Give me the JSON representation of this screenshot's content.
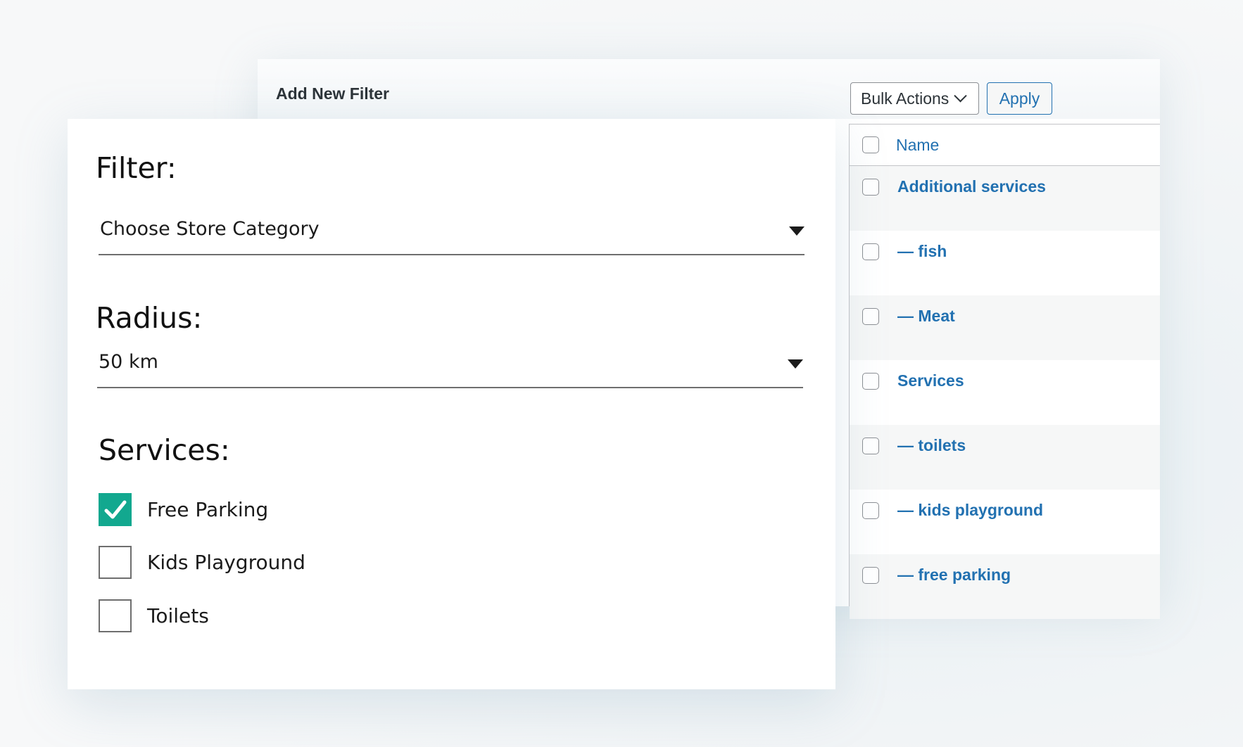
{
  "admin_panel": {
    "title": "Add New Filter",
    "bulk_actions": {
      "selected": "Bulk Actions"
    },
    "apply_label": "Apply",
    "table": {
      "column_header": "Name",
      "rows": [
        {
          "name": "Additional services"
        },
        {
          "name": "— fish"
        },
        {
          "name": "— Meat"
        },
        {
          "name": "Services"
        },
        {
          "name": "— toilets"
        },
        {
          "name": "— kids playground"
        },
        {
          "name": "— free parking"
        }
      ]
    }
  },
  "filter_form": {
    "filter_label": "Filter:",
    "category_select": {
      "value": "Choose Store Category"
    },
    "radius_label": "Radius:",
    "radius_select": {
      "value": "50 km"
    },
    "services_label": "Services:",
    "services": [
      {
        "label": "Free Parking",
        "checked": true
      },
      {
        "label": "Kids Playground",
        "checked": false
      },
      {
        "label": "Toilets",
        "checked": false
      }
    ]
  },
  "colors": {
    "link_blue": "#2271b1",
    "checkbox_green": "#12a88f",
    "text_dark": "#2c3338"
  }
}
